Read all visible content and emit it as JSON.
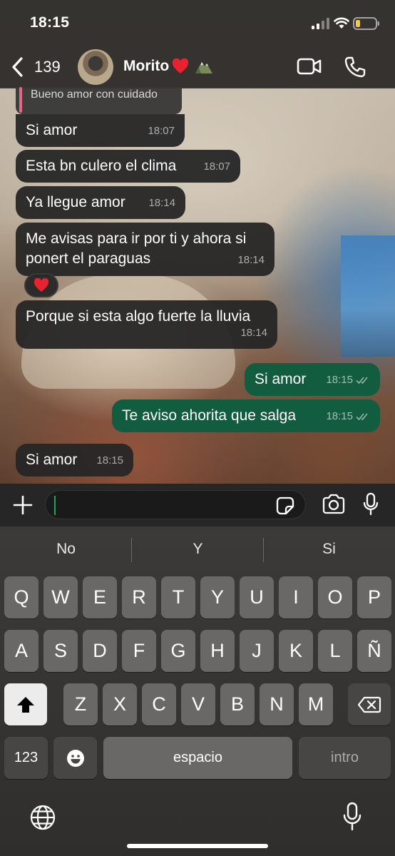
{
  "status_bar": {
    "time": "18:15"
  },
  "header": {
    "back_count": "139",
    "contact_name": "Morito"
  },
  "quoted_message": {
    "text": "Bueno amor con cuidado"
  },
  "messages": [
    {
      "direction": "incoming",
      "text": "Si amor",
      "time": "18:07"
    },
    {
      "direction": "incoming",
      "text": "Esta bn culero el clima",
      "time": "18:07"
    },
    {
      "direction": "incoming",
      "text": "Ya llegue amor",
      "time": "18:14"
    },
    {
      "direction": "incoming",
      "text_line1": "Me avisas para ir por ti y ahora si",
      "text_line2": "ponert el paraguas",
      "time": "18:14",
      "reaction": "red-heart"
    },
    {
      "direction": "incoming",
      "text": "Porque si esta algo fuerte la lluvia",
      "time": "18:14"
    },
    {
      "direction": "outgoing",
      "text": "Si amor",
      "time": "18:15",
      "status": "read"
    },
    {
      "direction": "outgoing",
      "text": "Te aviso ahorita que salga",
      "time": "18:15",
      "status": "read"
    },
    {
      "direction": "incoming",
      "text": "Si amor",
      "time": "18:15"
    }
  ],
  "input": {
    "value": ""
  },
  "keyboard": {
    "suggestions": [
      "No",
      "Y",
      "Si"
    ],
    "row1": [
      "Q",
      "W",
      "E",
      "R",
      "T",
      "Y",
      "U",
      "I",
      "O",
      "P"
    ],
    "row2": [
      "A",
      "S",
      "D",
      "F",
      "G",
      "H",
      "J",
      "K",
      "L",
      "Ñ"
    ],
    "row3": [
      "Z",
      "X",
      "C",
      "V",
      "B",
      "N",
      "M"
    ],
    "numbers_key": "123",
    "space_key": "espacio",
    "return_key": "intro"
  },
  "colors": {
    "outgoing_bubble": "#125c3f",
    "incoming_bubble": "#262626",
    "quote_accent": "#e26a85",
    "read_ticks": "#8fb7a3"
  },
  "icons": [
    "back-chevron-icon",
    "signal-icon",
    "wifi-icon",
    "battery-icon",
    "video-camera-icon",
    "phone-icon",
    "plus-icon",
    "sticker-icon",
    "camera-icon",
    "microphone-icon",
    "globe-icon",
    "shift-icon",
    "backspace-icon",
    "emoji-icon"
  ]
}
